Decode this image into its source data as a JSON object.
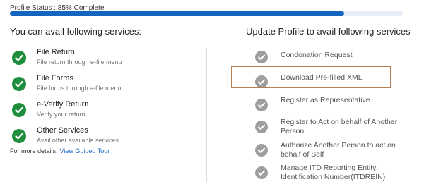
{
  "profile": {
    "status_text": "Profile Status : 85% Complete",
    "progress_percent": 85,
    "accent_color": "#1565c0"
  },
  "left": {
    "heading": "You can avail following services:",
    "items": [
      {
        "title": "File Return",
        "subtitle": "File return through e-file menu",
        "icon": "green-check-icon"
      },
      {
        "title": "File Forms",
        "subtitle": "File forms through e-file menu",
        "icon": "green-check-icon"
      },
      {
        "title": "e-Verify Return",
        "subtitle": "Verify your return",
        "icon": "green-check-icon"
      },
      {
        "title": "Other Services",
        "subtitle": "Avail other available services",
        "icon": "green-check-icon"
      }
    ],
    "more_details_label": "For more details:",
    "guided_tour_link": "View Guided Tour"
  },
  "right": {
    "heading": "Update Profile to avail following services",
    "items": [
      {
        "line1": "Condonation Request",
        "line2": "",
        "icon": "grey-check-icon"
      },
      {
        "line1": "Download Pre-filled XML",
        "line2": "",
        "icon": "grey-check-icon",
        "highlighted": true
      },
      {
        "line1": "Register as Representative",
        "line2": "",
        "icon": "grey-check-icon"
      },
      {
        "line1": "Register to Act on behalf of Another",
        "line2": "Person",
        "icon": "grey-check-icon"
      },
      {
        "line1": "Authorize Another Person to act on",
        "line2": "behalf of Self",
        "icon": "grey-check-icon"
      },
      {
        "line1": "Manage ITD Reporting Entity",
        "line2": "Identification Number(ITDREIN)",
        "icon": "grey-check-icon"
      }
    ]
  },
  "colors": {
    "green_check": "#1e8e3e",
    "grey_check": "#9e9e9e",
    "highlight_border": "#b87e56",
    "link": "#1a66c9"
  }
}
